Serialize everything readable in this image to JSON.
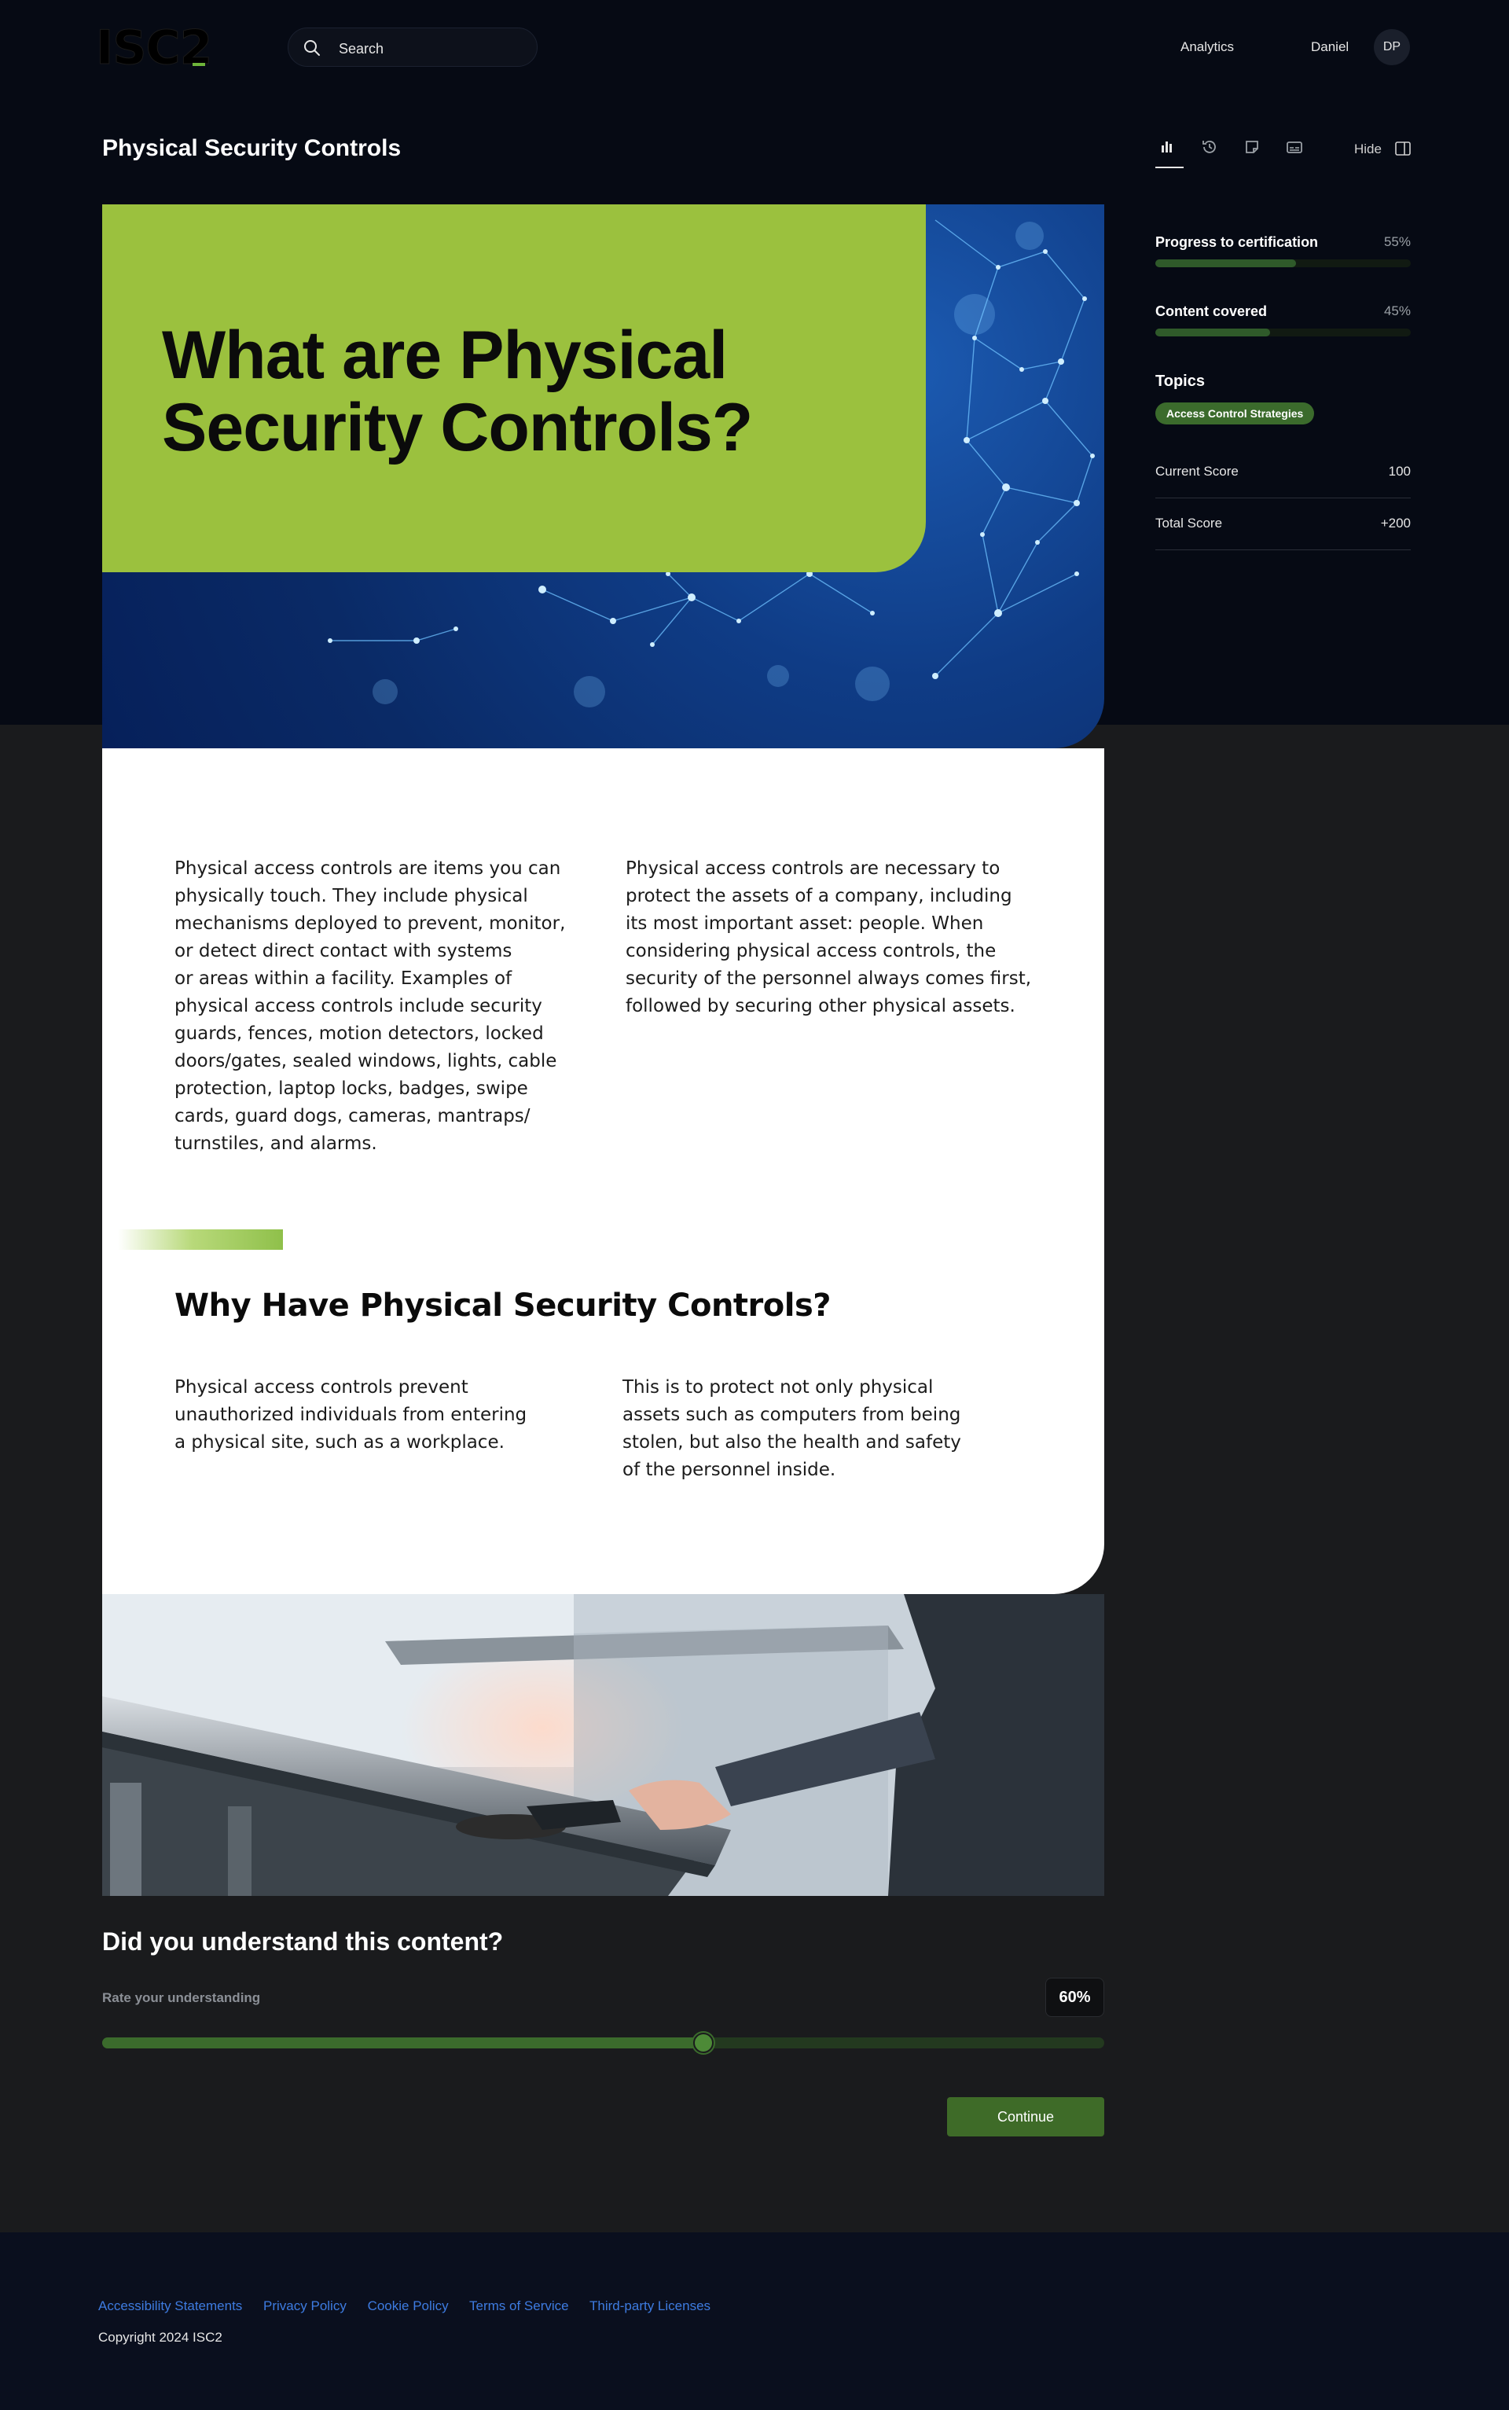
{
  "header": {
    "logo_text": "ISC2",
    "search_placeholder": "Search",
    "nav_analytics": "Analytics",
    "user_name": "Daniel",
    "user_initials": "DP"
  },
  "page": {
    "title": "Physical Security Controls",
    "hide_label": "Hide",
    "tool_icons": [
      "bar-chart-icon",
      "history-icon",
      "note-icon",
      "captions-icon"
    ]
  },
  "hero": {
    "title_line1": "What are Physical",
    "title_line2": "Security Controls?"
  },
  "article": {
    "col1": "Physical access controls are items you can\nphysically touch. They include physical\nmechanisms deployed to prevent, monitor,\nor detect direct contact with systems\nor areas within a facility. Examples of\nphysical access controls include security\nguards, fences, motion detectors, locked\ndoors/gates, sealed windows, lights, cable\nprotection, laptop locks, badges, swipe\ncards, guard dogs, cameras, mantraps/\nturnstiles, and alarms.",
    "col2": "Physical access controls are necessary to\nprotect the assets of a company, including\nits most important asset: people. When\nconsidering physical access controls, the\nsecurity of the personnel always comes first,\nfollowed by securing other physical assets.",
    "subheading": "Why Have Physical Security Controls?",
    "col3": "Physical access controls prevent\nunauthorized individuals from entering\na physical site, such as a workplace.",
    "col4": "This is to protect not only physical\n assets such as computers from being\n stolen, but also the health and safety\n of the personnel inside."
  },
  "rating": {
    "question": "Did you understand this content?",
    "label": "Rate your understanding",
    "value_text": "60%",
    "value": 0.6,
    "continue_label": "Continue"
  },
  "sidebar": {
    "progress_label": "Progress to certification",
    "progress_value_text": "55%",
    "progress": 0.55,
    "content_label": "Content covered",
    "content_value_text": "45%",
    "content": 0.45,
    "topics_label": "Topics",
    "topic": "Access Control Strategies",
    "current_score_label": "Current Score",
    "current_score": "100",
    "total_score_label": "Total Score",
    "total_score": "+200"
  },
  "footer": {
    "links": [
      "Accessibility Statements",
      "Privacy Policy",
      "Cookie Policy",
      "Terms of Service",
      "Third-party Licenses"
    ],
    "copyright": "Copyright 2024 ISC2"
  },
  "colors": {
    "accent_green": "#3b6b2c",
    "hero_green": "#9bc13e",
    "link_blue": "#3d7be0",
    "background_dark": "#060a14"
  }
}
